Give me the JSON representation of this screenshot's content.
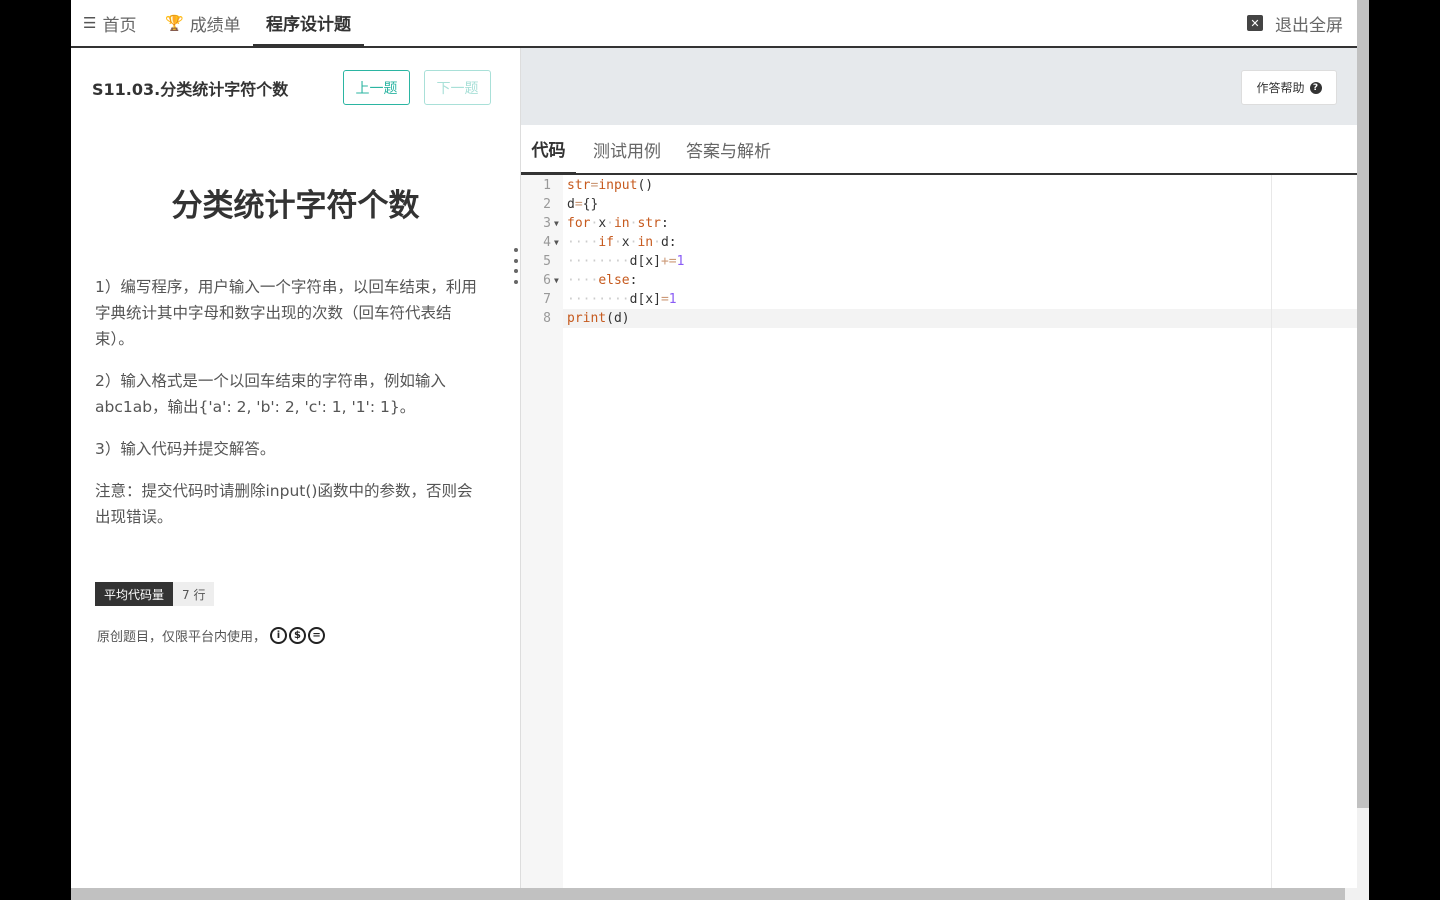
{
  "nav": {
    "home": "首页",
    "score": "成绩单",
    "program": "程序设计题",
    "exit": "退出全屏"
  },
  "question": {
    "code": "S11.03.分类统计字符个数",
    "prev": "上一题",
    "next": "下一题",
    "title": "分类统计字符个数",
    "paragraphs": [
      "1）编写程序，用户输入一个字符串，以回车结束，利用字典统计其中字母和数字出现的次数（回车符代表结束）。",
      "2）输入格式是一个以回车结束的字符串，例如输入abc1ab，输出{'a': 2, 'b': 2, 'c': 1, '1': 1}。",
      "3）输入代码并提交解答。",
      "注意：提交代码时请删除input()函数中的参数，否则会出现错误。"
    ],
    "badge_label": "平均代码量",
    "badge_value": "7 行",
    "license": "原创题目，仅限平台内使用，"
  },
  "editor_panel": {
    "help": "作答帮助",
    "tabs": [
      "代码",
      "测试用例",
      "答案与解析"
    ]
  },
  "code_lines": [
    "str=input()",
    "d={}",
    "for x in str:",
    "    if x in d:",
    "        d[x]+=1",
    "    else:",
    "        d[x]=1",
    "print(d)"
  ],
  "icons": {
    "home": "menu-icon",
    "score": "trophy-icon",
    "exit": "close-square-icon",
    "help": "question-circle-icon"
  },
  "colors": {
    "accent": "#2bb5a2",
    "keyword": "#c65a1e"
  }
}
